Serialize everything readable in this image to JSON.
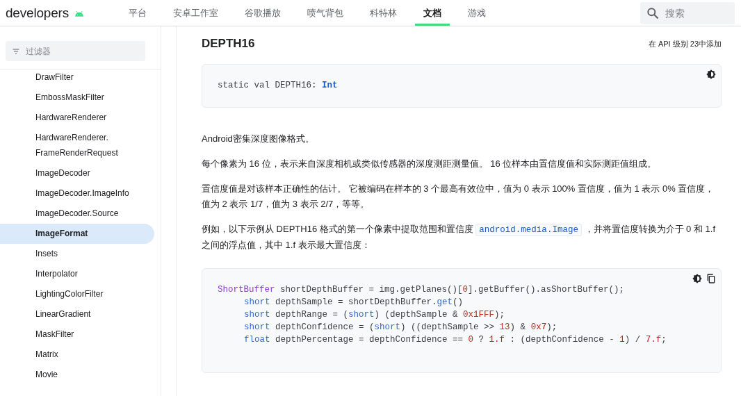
{
  "header": {
    "logo": "developers",
    "nav": [
      {
        "label": "平台",
        "selected": false
      },
      {
        "label": "安卓工作室",
        "selected": false
      },
      {
        "label": "谷歌播放",
        "selected": false
      },
      {
        "label": "喷气背包",
        "selected": false
      },
      {
        "label": "科特林",
        "selected": false
      },
      {
        "label": "文档",
        "selected": true
      },
      {
        "label": "游戏",
        "selected": false
      }
    ],
    "search": {
      "placeholder": "搜索"
    }
  },
  "sidebar": {
    "filter": {
      "placeholder": "过滤器"
    },
    "items": [
      {
        "label": "DrawFilter",
        "selected": false
      },
      {
        "label": "EmbossMaskFilter",
        "selected": false
      },
      {
        "label": "HardwareRenderer",
        "selected": false
      },
      {
        "label": "HardwareRenderer.\nFrameRenderRequest",
        "selected": false
      },
      {
        "label": "ImageDecoder",
        "selected": false
      },
      {
        "label": "ImageDecoder.ImageInfo",
        "selected": false
      },
      {
        "label": "ImageDecoder.Source",
        "selected": false
      },
      {
        "label": "ImageFormat",
        "selected": true
      },
      {
        "label": "Insets",
        "selected": false
      },
      {
        "label": "Interpolator",
        "selected": false
      },
      {
        "label": "LightingColorFilter",
        "selected": false
      },
      {
        "label": "LinearGradient",
        "selected": false
      },
      {
        "label": "MaskFilter",
        "selected": false
      },
      {
        "label": "Matrix",
        "selected": false
      },
      {
        "label": "Movie",
        "selected": false
      }
    ]
  },
  "content": {
    "title": "DEPTH16",
    "added": "在 API 级别 23中添加",
    "signature": {
      "copy": false,
      "lines": [
        {
          "indented": false,
          "tokens": [
            {
              "kind": "plain",
              "text": "static val DEPTH16: "
            },
            {
              "kind": "typebold",
              "text": "Int"
            }
          ]
        }
      ]
    },
    "paragraphs": [
      [
        {
          "kind": "text",
          "text": "Android密集深度图像格式。"
        }
      ],
      [
        {
          "kind": "text",
          "text": "每个像素为 16 位，表示来自深度相机或类似传感器的深度测距测量值。 16 位样本由置信度值和实际测距值组成。"
        }
      ],
      [
        {
          "kind": "text",
          "text": "置信度值是对该样本正确性的估计。 它被编码在样本的 3 个最高有效位中，值为 0 表示 100% 置信度，值为 1 表示 0% 置信度，值为 2 表示 1/7，值为 3 表示 2/7，等等。"
        }
      ],
      [
        {
          "kind": "text",
          "text": "例如，以下示例从 DEPTH16 格式的第一个像素中提取范围和置信度 "
        },
        {
          "kind": "code",
          "text": "android.media.Image"
        },
        {
          "kind": "text",
          "text": " ，并将置信度转换为介于 0 和 1.f 之间的浮点值，其中 1.f 表示最大置信度："
        }
      ]
    ],
    "example": {
      "copy": true,
      "lines": [
        {
          "indented": false,
          "tokens": [
            {
              "kind": "type",
              "text": "ShortBuffer"
            },
            {
              "kind": "plain",
              "text": " shortDepthBuffer = img.getPlanes()["
            },
            {
              "kind": "number",
              "text": "0"
            },
            {
              "kind": "plain",
              "text": "].getBuffer().asShortBuffer();"
            }
          ]
        },
        {
          "indented": true,
          "tokens": [
            {
              "kind": "keyword",
              "text": "short"
            },
            {
              "kind": "plain",
              "text": " depthSample = shortDepthBuffer."
            },
            {
              "kind": "keyword",
              "text": "get"
            },
            {
              "kind": "plain",
              "text": "()"
            }
          ]
        },
        {
          "indented": true,
          "tokens": [
            {
              "kind": "keyword",
              "text": "short"
            },
            {
              "kind": "plain",
              "text": " depthRange = ("
            },
            {
              "kind": "keyword",
              "text": "short"
            },
            {
              "kind": "plain",
              "text": ") (depthSample & "
            },
            {
              "kind": "number",
              "text": "0x1FFF"
            },
            {
              "kind": "plain",
              "text": ");"
            }
          ]
        },
        {
          "indented": true,
          "tokens": [
            {
              "kind": "keyword",
              "text": "short"
            },
            {
              "kind": "plain",
              "text": " depthConfidence = ("
            },
            {
              "kind": "keyword",
              "text": "short"
            },
            {
              "kind": "plain",
              "text": ") ((depthSample >> "
            },
            {
              "kind": "number",
              "text": "13"
            },
            {
              "kind": "plain",
              "text": ") & "
            },
            {
              "kind": "number",
              "text": "0x7"
            },
            {
              "kind": "plain",
              "text": ");"
            }
          ]
        },
        {
          "indented": true,
          "tokens": [
            {
              "kind": "keyword",
              "text": "float"
            },
            {
              "kind": "plain",
              "text": " depthPercentage = depthConfidence == "
            },
            {
              "kind": "number",
              "text": "0"
            },
            {
              "kind": "plain",
              "text": " ? "
            },
            {
              "kind": "number",
              "text": "1.f"
            },
            {
              "kind": "plain",
              "text": " : (depthConfidence - "
            },
            {
              "kind": "number",
              "text": "1"
            },
            {
              "kind": "plain",
              "text": ") / "
            },
            {
              "kind": "number",
              "text": "7.f"
            },
            {
              "kind": "plain",
              "text": ";"
            }
          ]
        }
      ]
    }
  }
}
